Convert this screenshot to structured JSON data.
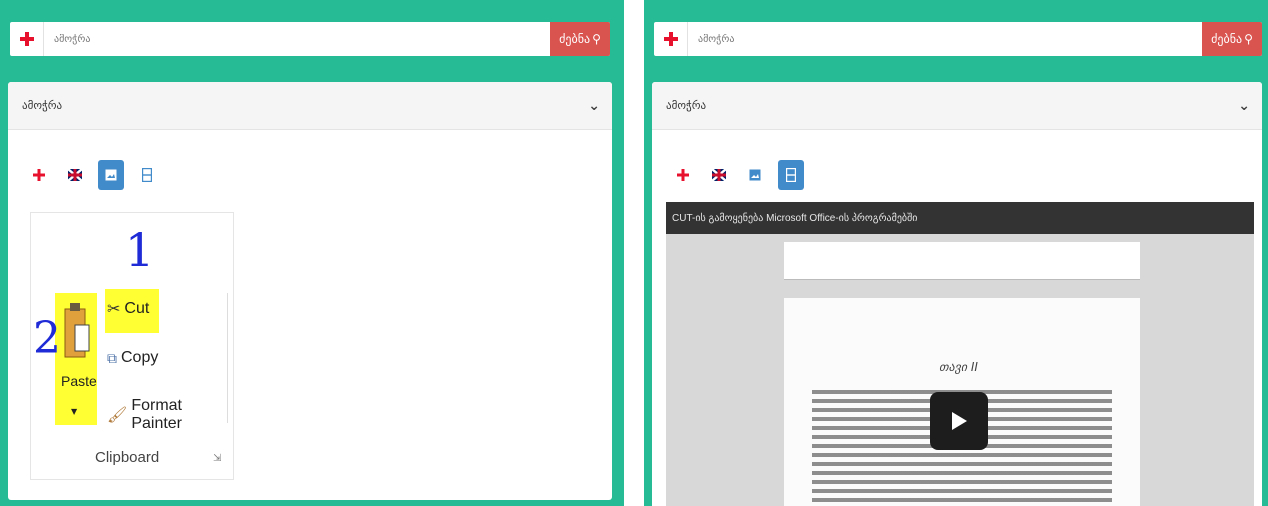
{
  "left_panel": {
    "search": {
      "value": "ამოჭრა",
      "button_label": "ძებნა"
    },
    "card": {
      "title": "ამოჭრა",
      "ribbon": {
        "paste_label": "Paste",
        "cut_label": "Cut",
        "copy_label": "Copy",
        "format_painter_label": "Format Painter",
        "group_label": "Clipboard"
      },
      "annotations": {
        "mark_1": "1",
        "mark_2": "2"
      }
    }
  },
  "right_panel": {
    "search": {
      "value": "ამოჭრა",
      "button_label": "ძებნა"
    },
    "card": {
      "title": "ამოჭრა",
      "video": {
        "title": "CUT-ის გამოყენება Microsoft Office-ის პროგრამებში",
        "document_heading": "თავი II"
      }
    }
  },
  "colors": {
    "panel_bg": "#26bb94",
    "search_button": "#d9534f",
    "active_tab": "#428bca",
    "highlight": "#ffff33",
    "handwriting": "#1f2bd6"
  },
  "icons": {
    "language_flags": [
      "georgian-flag-icon",
      "uk-flag-icon"
    ],
    "content_types": [
      "image-icon",
      "video-icon"
    ]
  }
}
